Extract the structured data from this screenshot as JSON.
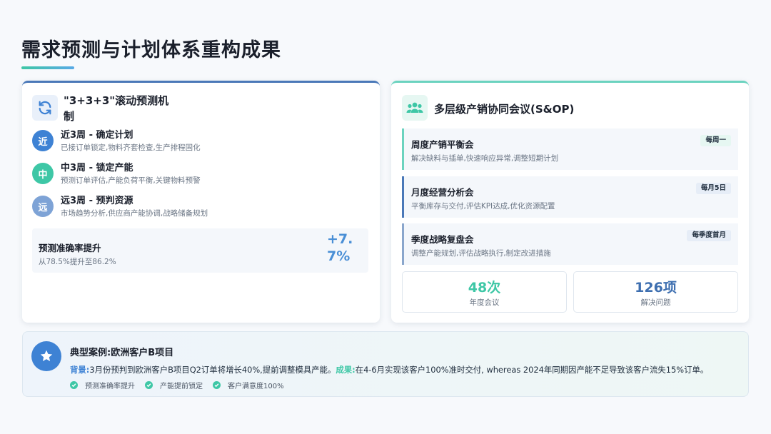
{
  "page": {
    "title": "需求预测与计划体系重构成果"
  },
  "forecast": {
    "title": "\"3+3+3\"滚动预测机制",
    "phases": [
      {
        "badge": "近",
        "color": "#3e82d4",
        "title": "近3周 - 确定计划",
        "desc": "已接订单锁定,物料齐套检查,生产排程固化"
      },
      {
        "badge": "中",
        "color": "#3ec7a6",
        "title": "中3周 - 锁定产能",
        "desc": "预测订单评估,产能负荷平衡,关键物料预警"
      },
      {
        "badge": "远",
        "color": "#7ea3d6",
        "title": "远3周 - 预判资源",
        "desc": "市场趋势分析,供应商产能协调,战略储备规划"
      }
    ],
    "accuracy": {
      "title": "预测准确率提升",
      "sub": "从78.5%提升至86.2%",
      "value": "+7.7%"
    }
  },
  "sop": {
    "title": "多层级产销协同会议(S&OP)",
    "meetings": [
      {
        "title": "周度产销平衡会",
        "desc": "解决缺料与插单,快速响应异常,调整短期计划",
        "tag": "每周一"
      },
      {
        "title": "月度经营分析会",
        "desc": "平衡库存与交付,评估KPI达成,优化资源配置",
        "tag": "每月5日"
      },
      {
        "title": "季度战略复盘会",
        "desc": "调整产能规划,评估战略执行,制定改进措施",
        "tag": "每季度首月"
      }
    ],
    "stats": [
      {
        "value": "48次",
        "label": "年度会议",
        "color": "#3ec7a6"
      },
      {
        "value": "126项",
        "label": "解决问题",
        "color": "#3e6fb0"
      }
    ]
  },
  "case": {
    "title": "典型案例:欧洲客户B项目",
    "bg_label": "背景:",
    "bg_text": "3月份预判到欧洲客户B项目Q2订单将增长40%,提前调整模具产能。",
    "res_label": "成果:",
    "res_text": "在4-6月实现该客户100%准时交付, whereas 2024年同期因产能不足导致该客户流失15%订单。",
    "checks": [
      "预测准确率提升",
      "产能提前锁定",
      "客户满意度100%"
    ]
  },
  "colors": {
    "accent_blue": "#3e82d4",
    "accent_teal": "#3ec7a6"
  }
}
